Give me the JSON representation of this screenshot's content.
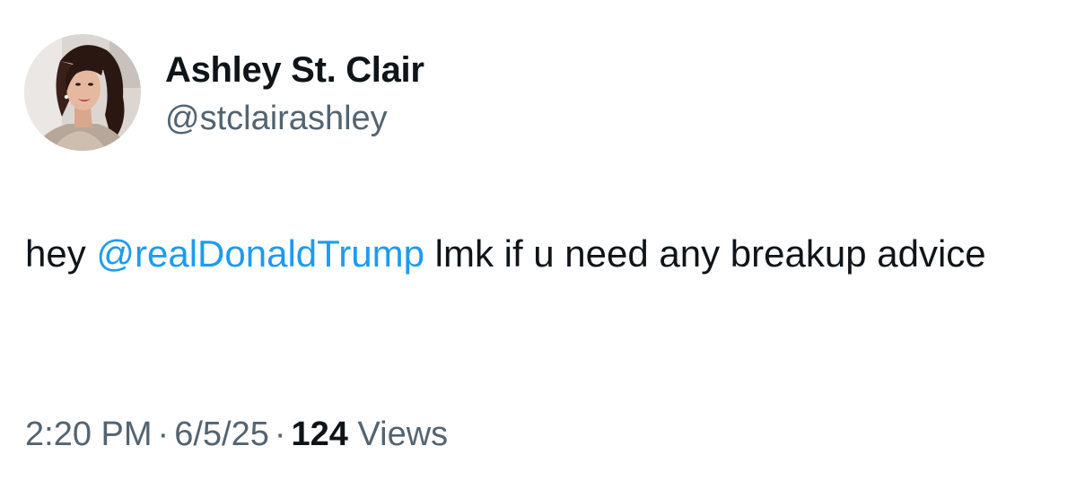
{
  "author": {
    "display_name": "Ashley St. Clair",
    "handle": "@stclairashley"
  },
  "tweet": {
    "text_before": "hey ",
    "mention": "@realDonaldTrump",
    "text_after": " lmk if u need any breakup advice"
  },
  "meta": {
    "time": "2:20 PM",
    "separator": "·",
    "date": "6/5/25",
    "views_count": "124",
    "views_label": "Views"
  },
  "colors": {
    "link": "#1d9bf0",
    "text_primary": "#0f1419",
    "text_secondary": "#536471"
  }
}
